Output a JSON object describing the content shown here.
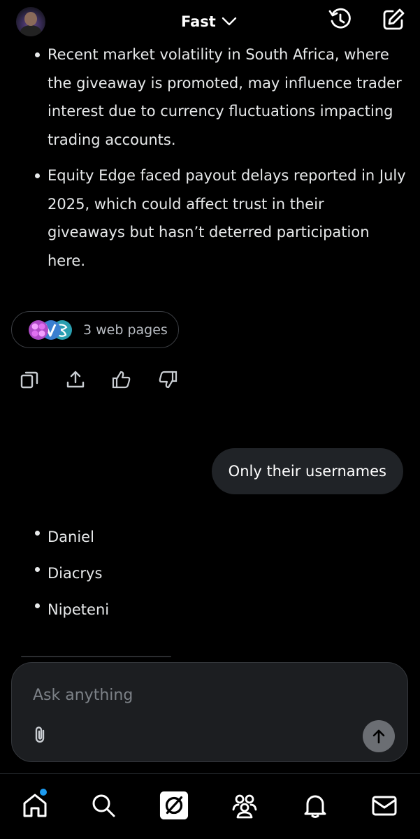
{
  "header": {
    "model_label": "Fast",
    "icons": {
      "history": "history-icon",
      "new_chat": "compose-icon",
      "chevron": "chevron-down-icon"
    }
  },
  "response_bullets": [
    "Recent market volatility in South Africa, where the giveaway is promoted, may influence trader interest due to currency fluctuations impacting trading accounts.",
    "Equity Edge faced payout delays reported in July 2025, which could affect trust in their giveaways but hasn’t deterred participation here."
  ],
  "sources": {
    "label": "3 web pages"
  },
  "actions": [
    "copy-icon",
    "share-icon",
    "thumbs-up-icon",
    "thumbs-down-icon"
  ],
  "user_message": "Only their usernames",
  "names": [
    "Daniel",
    "Diacrys",
    "Nipeteni"
  ],
  "composer": {
    "placeholder": "Ask anything",
    "icons": [
      "paperclip-icon",
      "arrow-up-icon"
    ]
  },
  "bottom_nav": [
    "home-icon",
    "search-icon",
    "grok-icon",
    "communities-icon",
    "bell-icon",
    "mail-icon"
  ],
  "colors": {
    "background": "#000000",
    "bubble": "#202327",
    "composer": "#1c1e21",
    "accent": "#1d9bf0"
  }
}
